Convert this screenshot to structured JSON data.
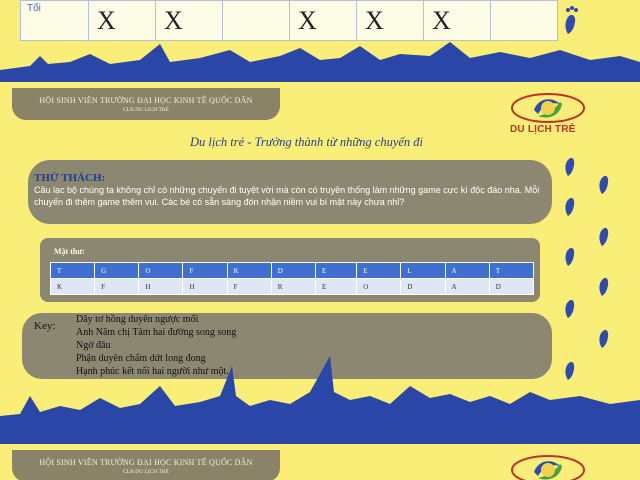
{
  "schedule": {
    "row_label": "Tối",
    "cells": [
      "X",
      "X",
      "",
      "X",
      "X",
      "X",
      ""
    ]
  },
  "header": {
    "line1": "HỘI SINH VIÊN TRƯỜNG ĐẠI HỌC KINH TẾ QUỐC DÂN",
    "line2": "CLB DU LỊCH TRẺ",
    "logo_text": "DU LỊCH TRẺ"
  },
  "slogan": "Du lịch trẻ - Trưởng thành từ những chuyến đi",
  "challenge": {
    "title": "THỬ THÁCH:",
    "text": "Câu lạc bộ chúng ta không chỉ có những chuyến đi tuyệt vời mà còn có truyền thống làm những game cực kì độc đáo nha. Mỗi chuyến đi thêm game thêm vui. Các bé có sẵn sàng đón nhận niềm vui bí mật này chưa nhỉ?"
  },
  "code": {
    "label": "Mật thư:",
    "header": [
      "T",
      "G",
      "O",
      "F",
      "K",
      "D",
      "E",
      "E",
      "L",
      "A",
      "T"
    ],
    "row": [
      "K",
      "F",
      "H",
      "H",
      "F",
      "R",
      "E",
      "O",
      "D",
      "A",
      "D"
    ]
  },
  "key": {
    "label": "Key:",
    "lines": [
      "Dây tơ hồng duyên ngược mối",
      "Anh Năm chị Tám hai đường song song",
      "Ngờ đâu",
      "Phận duyên chấm dứt long đong",
      "Hạnh phúc kết nối hai người như một."
    ]
  },
  "colors": {
    "background": "#f8ee78",
    "panel": "#8c8770",
    "navy": "#1f3c9a",
    "table_header": "#3f6fcf",
    "logo_red": "#c0322a"
  }
}
